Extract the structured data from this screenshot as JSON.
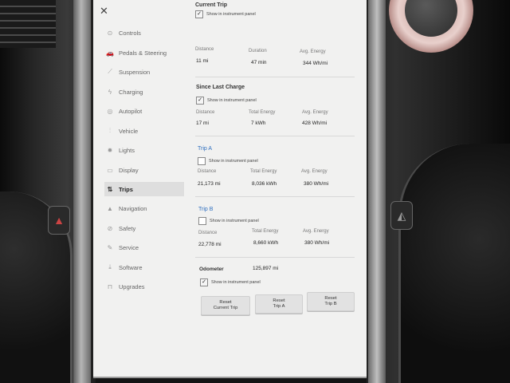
{
  "nav": {
    "items": [
      {
        "label": "Controls",
        "icon": "toggle-icon",
        "glyph": "⊙"
      },
      {
        "label": "Pedals & Steering",
        "icon": "car-icon",
        "glyph": "🚗"
      },
      {
        "label": "Suspension",
        "icon": "suspension-icon",
        "glyph": "⟋"
      },
      {
        "label": "Charging",
        "icon": "bolt-icon",
        "glyph": "ϟ"
      },
      {
        "label": "Autopilot",
        "icon": "steering-wheel-icon",
        "glyph": "◎"
      },
      {
        "label": "Vehicle",
        "icon": "sliders-icon",
        "glyph": "⫶"
      },
      {
        "label": "Lights",
        "icon": "light-icon",
        "glyph": "✹"
      },
      {
        "label": "Display",
        "icon": "display-icon",
        "glyph": "▭"
      },
      {
        "label": "Trips",
        "icon": "trips-icon",
        "glyph": "⇅",
        "active": true
      },
      {
        "label": "Navigation",
        "icon": "navigation-arrow-icon",
        "glyph": "▲"
      },
      {
        "label": "Safety",
        "icon": "shield-icon",
        "glyph": "⊘"
      },
      {
        "label": "Service",
        "icon": "wrench-icon",
        "glyph": "✎"
      },
      {
        "label": "Software",
        "icon": "download-icon",
        "glyph": "⤓"
      },
      {
        "label": "Upgrades",
        "icon": "lock-icon",
        "glyph": "⊓"
      }
    ]
  },
  "current_trip": {
    "title": "Current Trip",
    "show_label": "Show in instrument panel",
    "checked": true,
    "labels": [
      "Distance",
      "Duration",
      "Avg. Energy"
    ],
    "values": [
      "11 mi",
      "47 min",
      "344 Wh/mi"
    ]
  },
  "since_last_charge": {
    "title": "Since Last Charge",
    "show_label": "Show in instrument panel",
    "checked": true,
    "labels": [
      "Distance",
      "Total Energy",
      "Avg. Energy"
    ],
    "values": [
      "17 mi",
      "7 kWh",
      "428 Wh/mi"
    ]
  },
  "trip_a": {
    "title": "Trip A",
    "show_label": "Show in instrument panel",
    "checked": false,
    "labels": [
      "Distance",
      "Total Energy",
      "Avg. Energy"
    ],
    "values": [
      "21,173 mi",
      "8,036 kWh",
      "380 Wh/mi"
    ]
  },
  "trip_b": {
    "title": "Trip B",
    "show_label": "Show in instrument panel",
    "checked": false,
    "labels": [
      "Distance",
      "Total Energy",
      "Avg. Energy"
    ],
    "values": [
      "22,778 mi",
      "8,660 kWh",
      "380 Wh/mi"
    ]
  },
  "odometer": {
    "label": "Odometer",
    "value": "125,897 mi",
    "show_label": "Show in instrument panel",
    "checked": true
  },
  "buttons": {
    "reset_current": [
      "Reset",
      "Current Trip"
    ],
    "reset_a": [
      "Reset",
      "Trip A"
    ],
    "reset_b": [
      "Reset",
      "Trip B"
    ]
  },
  "check_mark": "✓",
  "close_glyph": "✕",
  "colors": {
    "accent": "#2f6fbf",
    "screen_bg": "#f1f1f0",
    "active_nav_bg": "#dedede"
  }
}
